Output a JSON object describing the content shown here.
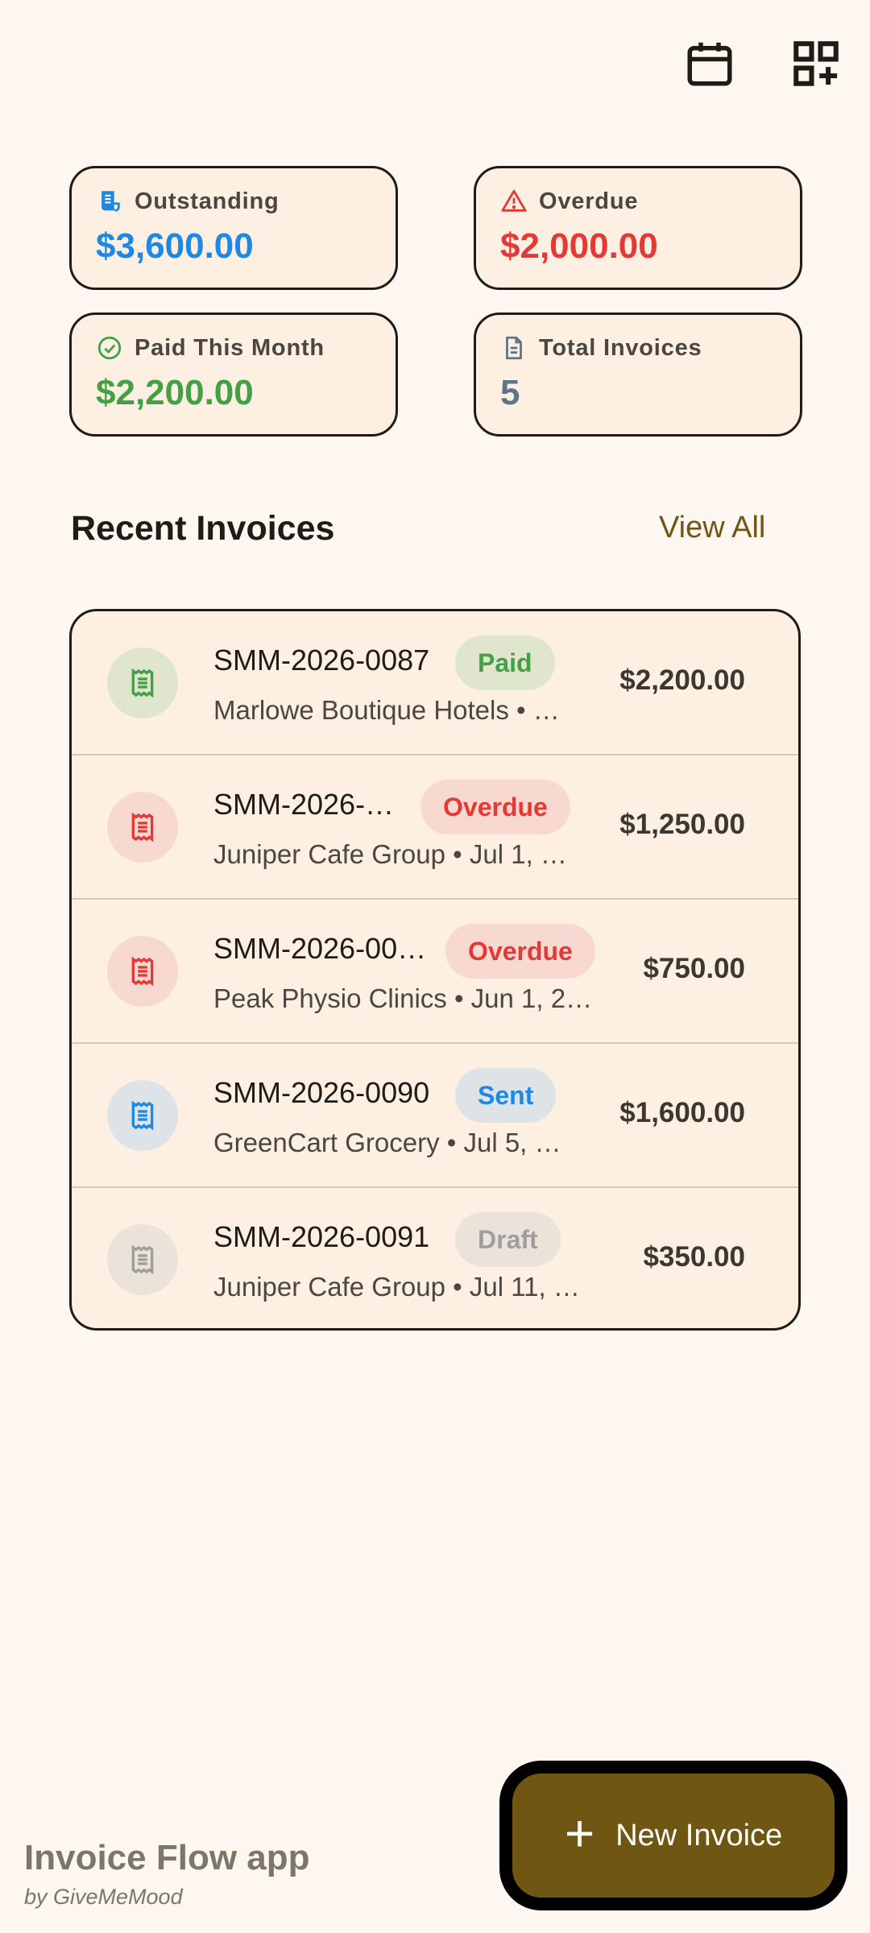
{
  "topbar": {
    "calendar_icon": "calendar-icon",
    "qr_icon": "qr-add-icon"
  },
  "stats": [
    {
      "label": "Outstanding",
      "value": "$3,600.00",
      "icon": "receipt-icon",
      "color": "#1e88e5"
    },
    {
      "label": "Overdue",
      "value": "$2,000.00",
      "icon": "warning-icon",
      "color": "#e53935"
    },
    {
      "label": "Paid This Month",
      "value": "$2,200.00",
      "icon": "check-circle-icon",
      "color": "#43a047"
    },
    {
      "label": "Total Invoices",
      "value": "5",
      "icon": "document-icon",
      "color": "#5f7585"
    }
  ],
  "recent": {
    "title": "Recent Invoices",
    "view_all": "View All"
  },
  "invoices": [
    {
      "number": "SMM-2026-0087",
      "status": "Paid",
      "subtitle": "Marlowe Boutique Hotels • …",
      "amount": "$2,200.00"
    },
    {
      "number": "SMM-2026-…",
      "status": "Overdue",
      "subtitle": "Juniper Cafe Group • Jul 1, …",
      "amount": "$1,250.00"
    },
    {
      "number": "SMM-2026-00…",
      "status": "Overdue",
      "subtitle": "Peak Physio Clinics • Jun 1, 2…",
      "amount": "$750.00"
    },
    {
      "number": "SMM-2026-0090",
      "status": "Sent",
      "subtitle": "GreenCart Grocery • Jul 5, …",
      "amount": "$1,600.00"
    },
    {
      "number": "SMM-2026-0091",
      "status": "Draft",
      "subtitle": "Juniper Cafe Group • Jul 11, …",
      "amount": "$350.00"
    }
  ],
  "status_colors": {
    "paid": "#43a047",
    "overdue": "#e53935",
    "sent": "#1e88e5",
    "draft": "#9e9e9e"
  },
  "footer": {
    "brand": "Invoice Flow app",
    "by": "by GiveMeMood"
  },
  "fab": {
    "label": "New Invoice",
    "icon": "plus-icon"
  }
}
